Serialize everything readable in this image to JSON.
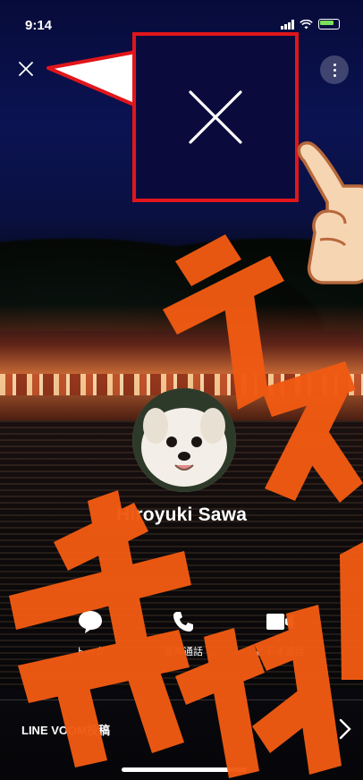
{
  "status_bar": {
    "time": "9:14"
  },
  "profile": {
    "name": "Hiroyuki Sawa"
  },
  "actions": [
    {
      "label": "トーク",
      "icon": "chat-bubble-icon"
    },
    {
      "label": "音声通話",
      "icon": "phone-icon"
    },
    {
      "label": "ビデオ通話",
      "icon": "video-camera-icon"
    }
  ],
  "voom": {
    "label": "LINE VOOM投稿"
  },
  "watermark": {
    "text": "テスト素材"
  },
  "colors": {
    "callout_border": "#e0161b",
    "watermark": "#f05a12",
    "background": "#0b1352"
  }
}
